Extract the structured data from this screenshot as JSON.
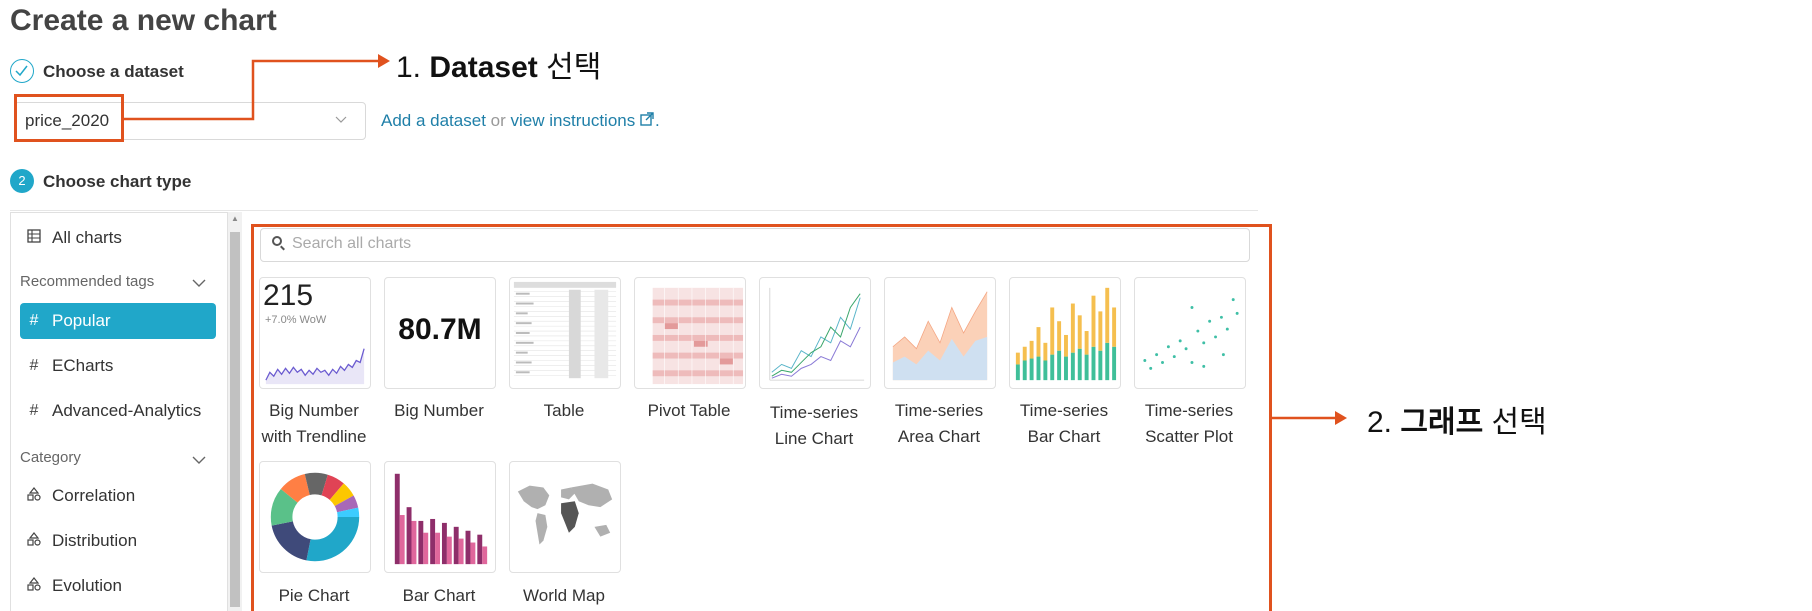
{
  "page": {
    "title": "Create a new chart"
  },
  "step1": {
    "label": "Choose a dataset",
    "dataset_value": "price_2020"
  },
  "dataset_actions": {
    "add": "Add a dataset",
    "or": "or",
    "view": "view instructions",
    "period": "."
  },
  "step2": {
    "number": "2",
    "label": "Choose chart type"
  },
  "sidebar": {
    "all_charts": "All charts",
    "recommended_tags": "Recommended tags",
    "tags": [
      "Popular",
      "ECharts",
      "Advanced-Analytics"
    ],
    "category": "Category",
    "categories": [
      "Correlation",
      "Distribution",
      "Evolution"
    ]
  },
  "search": {
    "placeholder": "Search all charts"
  },
  "charts": [
    {
      "line1": "Big Number",
      "line2": "with Trendline"
    },
    {
      "line1": "Big Number",
      "line2": ""
    },
    {
      "line1": "Table",
      "line2": ""
    },
    {
      "line1": "Pivot Table",
      "line2": ""
    },
    {
      "line1": "Time-series",
      "line2": "Line Chart"
    },
    {
      "line1": "Time-series",
      "line2": "Area Chart"
    },
    {
      "line1": "Time-series",
      "line2": "Bar Chart"
    },
    {
      "line1": "Time-series",
      "line2": "Scatter Plot"
    },
    {
      "line1": "Pie Chart",
      "line2": ""
    },
    {
      "line1": "Bar Chart",
      "line2": ""
    },
    {
      "line1": "World Map",
      "line2": ""
    }
  ],
  "thumbs": {
    "bignum_trend_value": "215",
    "bignum_trend_delta": "+7.0% WoW",
    "bignum_value": "80.7M"
  },
  "annotations": {
    "a1_num": "1.",
    "a1_bold": "Dataset",
    "a1_rest": "선택",
    "a2_num": "2.",
    "a2_bold": "그래프",
    "a2_rest": "선택"
  },
  "colors": {
    "accent": "#20a7c9",
    "annotation": "#e0521e",
    "link": "#1f7fa8"
  },
  "icons": [
    "check-icon",
    "chevron-down-icon",
    "external-link-icon",
    "table-icon",
    "hash-icon",
    "category-icon",
    "search-icon"
  ]
}
